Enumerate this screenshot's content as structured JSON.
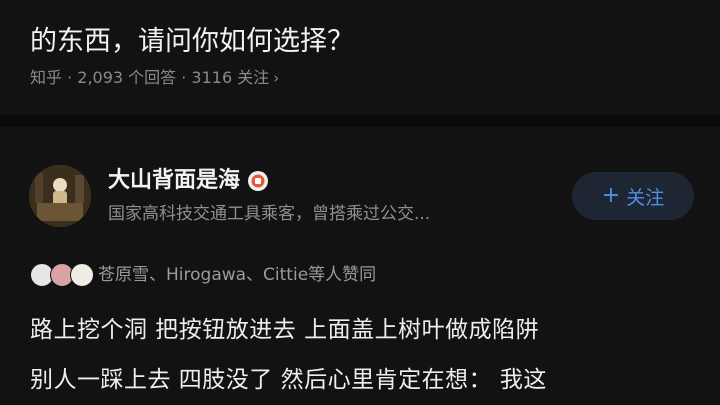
{
  "question": {
    "title_line": "的东西，请问你如何选择？",
    "meta": "知乎 · 2,093 个回答 · 3116 关注"
  },
  "author": {
    "name": "大山背面是海",
    "bio": "国家高科技交通工具乘客，曾搭乘过公交...",
    "follow_label": "关注"
  },
  "voters": {
    "text": "苍原雪、Hirogawa、Cittie等人赞同"
  },
  "answer": {
    "lines": [
      "路上挖个洞 把按钮放进去 上面盖上树叶做成陷阱",
      "别人一踩上去 四肢没了 然后心里肯定在想： 我这"
    ]
  }
}
